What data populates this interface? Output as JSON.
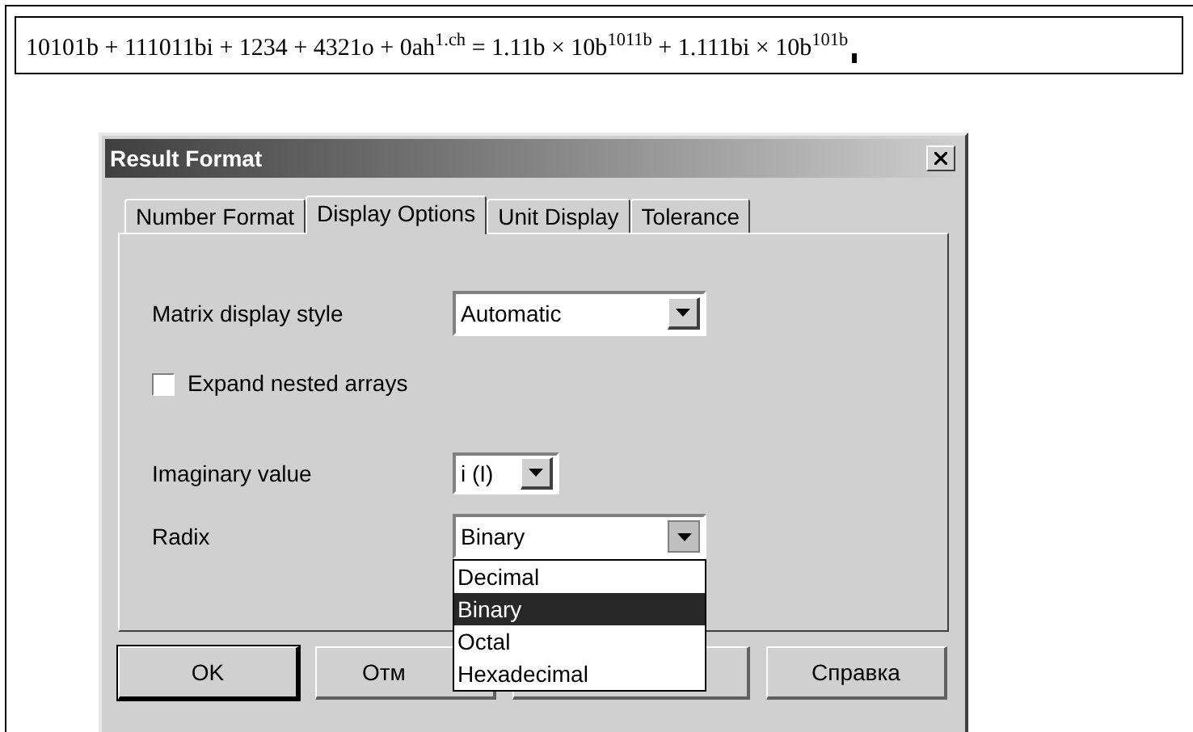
{
  "expression": "10101b + 111011bi + 1234 + 4321o + 0ah$^{1.ch}$ = 1.11b × 10b$^{1011b}$ + 1.111bi × 10b$^{101b}$",
  "dialog": {
    "title": "Result Format",
    "tabs": [
      {
        "label": "Number Format",
        "selected": false
      },
      {
        "label": "Display Options",
        "selected": true
      },
      {
        "label": "Unit Display",
        "selected": false
      },
      {
        "label": "Tolerance",
        "selected": false
      }
    ],
    "fields": [
      {
        "kind": "select",
        "label": "Matrix display style",
        "value": "Automatic"
      },
      {
        "kind": "checkbox",
        "label": "Expand nested arrays",
        "checked": false
      },
      {
        "kind": "small-select",
        "label": "Imaginary value",
        "value": "i (I)"
      },
      {
        "kind": "select",
        "label": "Radix",
        "value": "Binary",
        "expanded": true,
        "options": [
          {
            "label": "Decimal",
            "selected": false
          },
          {
            "label": "Binary",
            "selected": true
          },
          {
            "label": "Octal",
            "selected": false
          },
          {
            "label": "Hexadecimal",
            "selected": false
          }
        ]
      }
    ],
    "buttons": [
      {
        "label": "OK",
        "default": true
      },
      {
        "label": "Отм",
        "default": false
      },
      {
        "default": false
      },
      {
        "label": "Справка",
        "default": false
      }
    ]
  }
}
